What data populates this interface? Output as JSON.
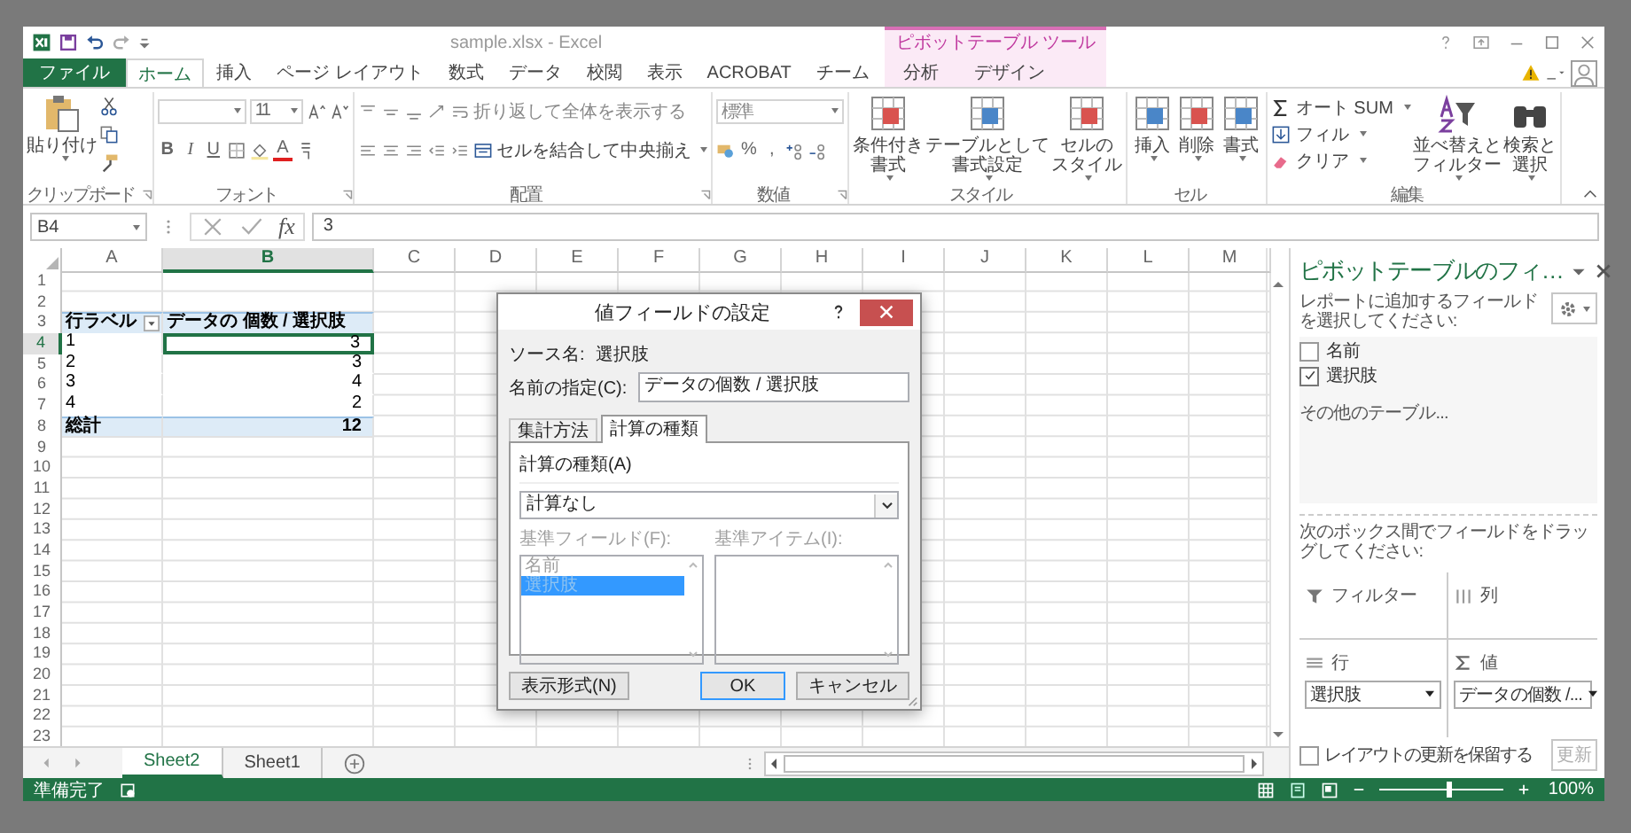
{
  "window": {
    "title": "sample.xlsx - Excel"
  },
  "tabs": [
    {
      "label": "ファイル",
      "kind": "file",
      "selected": false
    },
    {
      "label": "ホーム",
      "kind": "tab",
      "selected": true
    },
    {
      "label": "挿入",
      "kind": "tab",
      "selected": false
    },
    {
      "label": "ページ レイアウト",
      "kind": "tab",
      "selected": false
    },
    {
      "label": "数式",
      "kind": "tab",
      "selected": false
    },
    {
      "label": "データ",
      "kind": "tab",
      "selected": false
    },
    {
      "label": "校閲",
      "kind": "tab",
      "selected": false
    },
    {
      "label": "表示",
      "kind": "tab",
      "selected": false
    },
    {
      "label": "ACROBAT",
      "kind": "tab",
      "selected": false
    },
    {
      "label": "チーム",
      "kind": "tab",
      "selected": false
    }
  ],
  "context_group": {
    "label": "ピボットテーブル ツール",
    "tabs": [
      {
        "label": "分析",
        "selected": false
      },
      {
        "label": "デザイン",
        "selected": false
      }
    ]
  },
  "ribbon": {
    "groups": [
      {
        "kind": "clipboard",
        "label": "クリップボード",
        "launcher": true,
        "paste": "貼り付け"
      },
      {
        "kind": "font",
        "label": "フォント",
        "launcher": true,
        "font_size": "11",
        "styles": [
          "B",
          "I",
          "U"
        ],
        "color_letter": "A"
      },
      {
        "kind": "alignment",
        "label": "配置",
        "launcher": true,
        "wrap": "折り返して全体を表示する",
        "merge": "セルを結合して中央揃え"
      },
      {
        "kind": "number",
        "label": "数値",
        "launcher": true,
        "format": "標準",
        "symbols": [
          "%",
          ","
        ]
      },
      {
        "kind": "large",
        "label": "スタイル",
        "launcher": false,
        "buttons": [
          {
            "lines": [
              "条件付き",
              "書式"
            ]
          },
          {
            "lines": [
              "テーブルとして",
              "書式設定"
            ]
          },
          {
            "lines": [
              "セルの",
              "スタイル"
            ]
          }
        ]
      },
      {
        "kind": "large",
        "label": "セル",
        "launcher": false,
        "buttons": [
          {
            "lines": [
              "挿入"
            ]
          },
          {
            "lines": [
              "削除"
            ]
          },
          {
            "lines": [
              "書式"
            ]
          }
        ]
      },
      {
        "kind": "editing",
        "label": "編集",
        "launcher": false,
        "small": [
          "オート SUM",
          "フィル",
          "クリア"
        ],
        "buttons": [
          {
            "lines": [
              "並べ替えと",
              "フィルター"
            ]
          },
          {
            "lines": [
              "検索と",
              "選択"
            ]
          }
        ]
      }
    ]
  },
  "formula_bar": {
    "name_box": "B4",
    "function_label": "fx",
    "formula": "3"
  },
  "sheet": {
    "columns": [
      {
        "label": "A",
        "selected": false
      },
      {
        "label": "B",
        "selected": true
      },
      {
        "label": "C",
        "selected": false
      },
      {
        "label": "D",
        "selected": false
      },
      {
        "label": "E",
        "selected": false
      },
      {
        "label": "F",
        "selected": false
      },
      {
        "label": "G",
        "selected": false
      },
      {
        "label": "H",
        "selected": false
      },
      {
        "label": "I",
        "selected": false
      },
      {
        "label": "J",
        "selected": false
      },
      {
        "label": "K",
        "selected": false
      },
      {
        "label": "L",
        "selected": false
      },
      {
        "label": "M",
        "selected": false
      }
    ],
    "rows": [
      {
        "number": "1",
        "selected": false,
        "kind": "plain"
      },
      {
        "number": "2",
        "selected": false,
        "kind": "plain"
      },
      {
        "number": "3",
        "selected": false,
        "kind": "header",
        "cells": [
          {
            "text": "行ラベル",
            "active": false
          },
          {
            "text": "データの 個数 / 選択肢",
            "active": false
          }
        ]
      },
      {
        "number": "4",
        "selected": true,
        "kind": "item",
        "cells": [
          {
            "text": "1",
            "active": false
          },
          {
            "text": "3",
            "active": true
          }
        ]
      },
      {
        "number": "5",
        "selected": false,
        "kind": "item",
        "cells": [
          {
            "text": "2",
            "active": false
          },
          {
            "text": "3",
            "active": false
          }
        ]
      },
      {
        "number": "6",
        "selected": false,
        "kind": "item",
        "cells": [
          {
            "text": "3",
            "active": false
          },
          {
            "text": "4",
            "active": false
          }
        ]
      },
      {
        "number": "7",
        "selected": false,
        "kind": "item",
        "cells": [
          {
            "text": "4",
            "active": false
          },
          {
            "text": "2",
            "active": false
          }
        ]
      },
      {
        "number": "8",
        "selected": false,
        "kind": "total",
        "cells": [
          {
            "text": "総計",
            "active": false
          },
          {
            "text": "12",
            "active": false
          }
        ]
      },
      {
        "number": "9",
        "selected": false,
        "kind": "plain"
      },
      {
        "number": "10",
        "selected": false,
        "kind": "plain"
      },
      {
        "number": "11",
        "selected": false,
        "kind": "plain"
      },
      {
        "number": "12",
        "selected": false,
        "kind": "plain"
      },
      {
        "number": "13",
        "selected": false,
        "kind": "plain"
      },
      {
        "number": "14",
        "selected": false,
        "kind": "plain"
      },
      {
        "number": "15",
        "selected": false,
        "kind": "plain"
      },
      {
        "number": "16",
        "selected": false,
        "kind": "plain"
      },
      {
        "number": "17",
        "selected": false,
        "kind": "plain"
      },
      {
        "number": "18",
        "selected": false,
        "kind": "plain"
      },
      {
        "number": "19",
        "selected": false,
        "kind": "plain"
      },
      {
        "number": "20",
        "selected": false,
        "kind": "plain"
      },
      {
        "number": "21",
        "selected": false,
        "kind": "plain"
      },
      {
        "number": "22",
        "selected": false,
        "kind": "plain"
      },
      {
        "number": "23",
        "selected": false,
        "kind": "plain"
      }
    ]
  },
  "dialog": {
    "title": "値フィールドの設定",
    "source_label": "ソース名:",
    "source_name": "選択肢",
    "name_label": "名前の指定(C):",
    "name_value": "データの個数 / 選択肢",
    "tabs": [
      {
        "label": "集計方法",
        "selected": false
      },
      {
        "label": "計算の種類",
        "selected": true
      }
    ],
    "calc_label": "計算の種類(A)",
    "calc_value": "計算なし",
    "base_disabled": true,
    "base_field_label": "基準フィールド(F):",
    "base_fields": [
      {
        "label": "名前",
        "selected": false
      },
      {
        "label": "選択肢",
        "selected": true
      }
    ],
    "base_item_label": "基準アイテム(I):",
    "buttons": [
      {
        "label": "表示形式(N)",
        "kind": "left"
      },
      {
        "label": "OK",
        "kind": "default"
      },
      {
        "label": "キャンセル",
        "kind": "normal"
      }
    ]
  },
  "sheet_tabs": [
    {
      "label": "Sheet2",
      "selected": true
    },
    {
      "label": "Sheet1",
      "selected": false
    }
  ],
  "pivot_pane": {
    "title": "ピボットテーブルのフィ…",
    "instruction": "レポートに追加するフィールドを選択してください:",
    "fields": [
      {
        "label": "名前",
        "checked": false
      },
      {
        "label": "選択肢",
        "checked": true
      }
    ],
    "more_tables": "その他のテーブル...",
    "drag_hint": "次のボックス間でフィールドをドラッグしてください:",
    "areas": [
      {
        "kind": "filter",
        "label": "フィルター"
      },
      {
        "kind": "columns",
        "label": "列"
      },
      {
        "kind": "rows",
        "label": "行",
        "items": [
          "選択肢"
        ]
      },
      {
        "kind": "values",
        "label": "値",
        "items": [
          "データの個数 /..."
        ]
      }
    ],
    "defer": {
      "label": "レイアウトの更新を保留する",
      "checked": false
    },
    "update_button": {
      "label": "更新",
      "disabled": true
    }
  },
  "status_bar": {
    "status": "準備完了",
    "zoom": {
      "level": 0.55,
      "reading": "100%"
    }
  }
}
